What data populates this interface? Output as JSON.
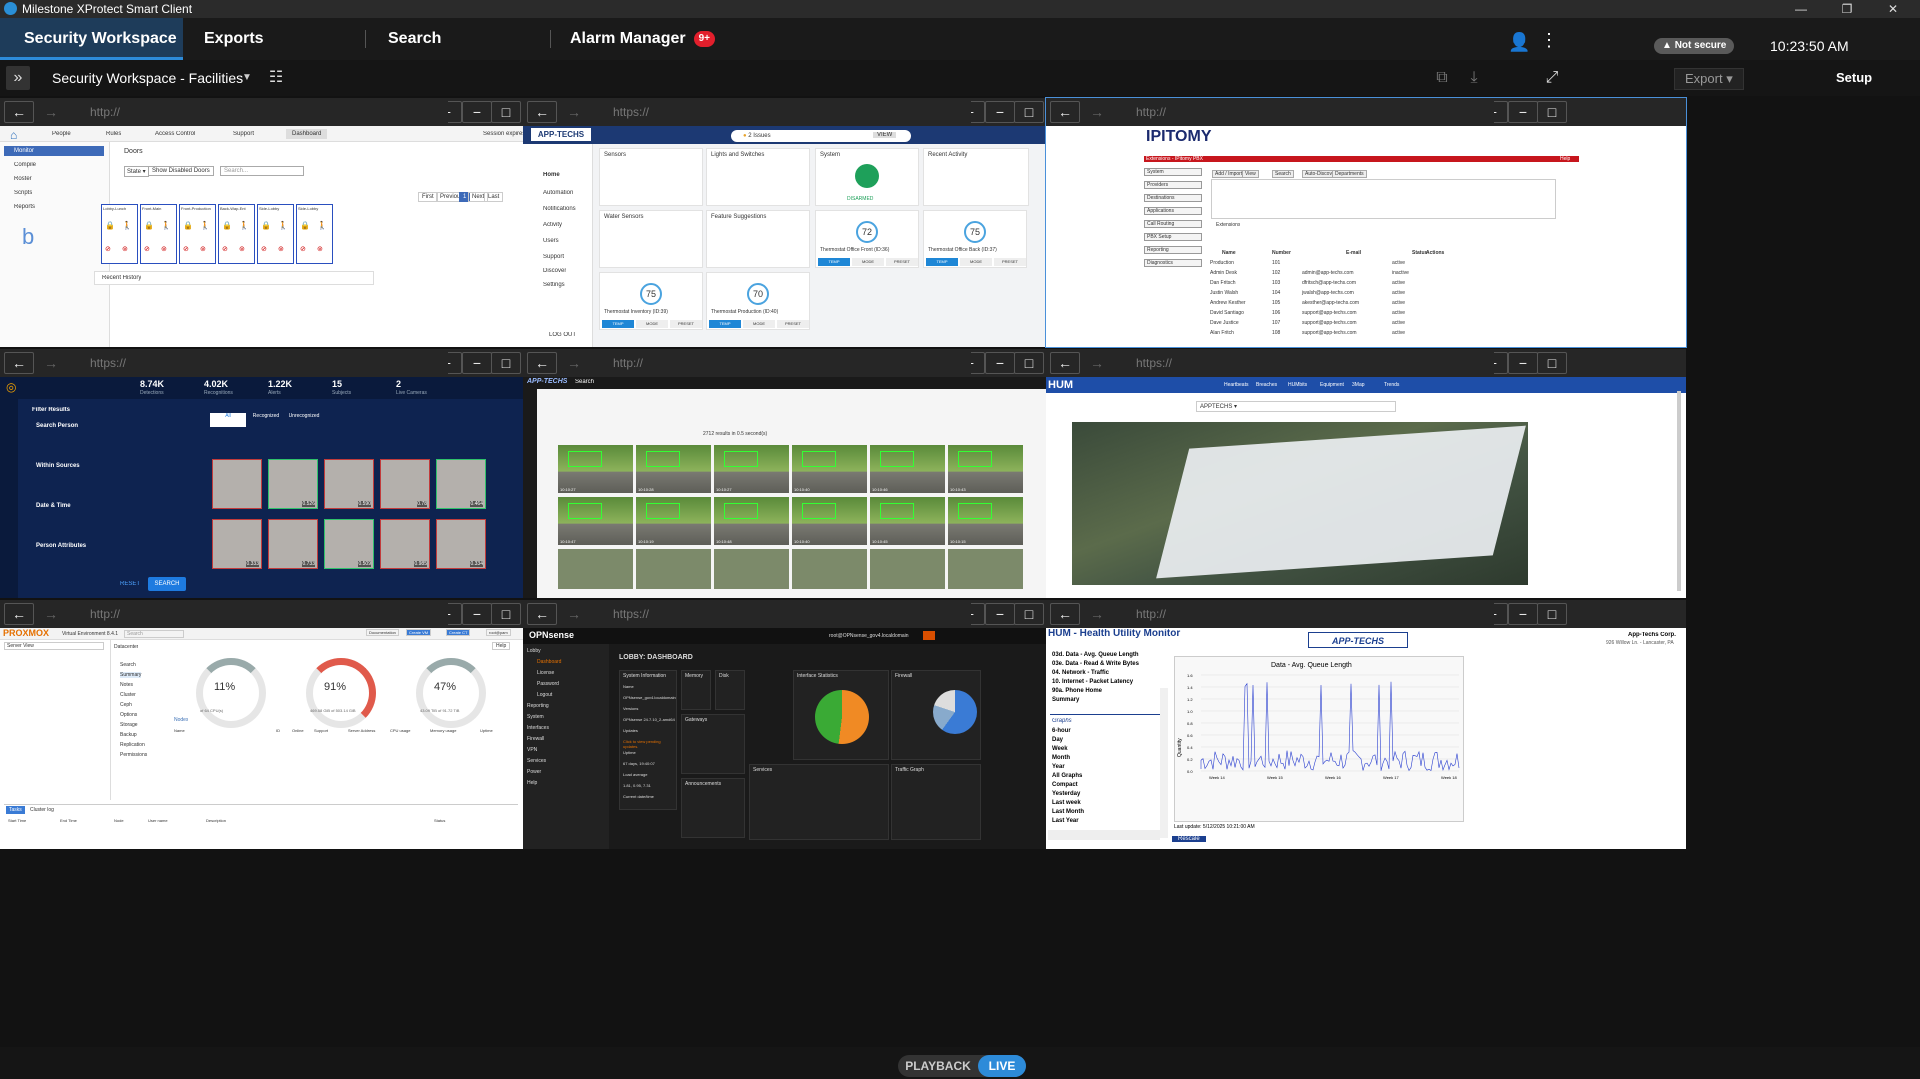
{
  "app": {
    "title": "Milestone XProtect Smart Client",
    "window_controls": [
      "—",
      "❐",
      "✕"
    ]
  },
  "tabs": [
    {
      "label": "Security Workspace -...",
      "active": true
    },
    {
      "label": "Exports",
      "active": false
    },
    {
      "label": "Search",
      "active": false
    },
    {
      "label": "Alarm Manager",
      "active": false,
      "badge": "9+"
    }
  ],
  "status": {
    "security": "Not secure",
    "time": "10:23:50 AM"
  },
  "workspace": {
    "name": "Security Workspace - Facilities",
    "export_label": "Export",
    "setup_label": "Setup"
  },
  "nav_icons": {
    "back": "←",
    "forward": "→",
    "home": "⌂",
    "reload": "⟳",
    "zoom_in": "+",
    "zoom_out": "−",
    "max": "□"
  },
  "panes": [
    {
      "url": "http://",
      "title": "Access control dashboard",
      "app": {
        "nav": [
          "People",
          "Rules",
          "Access Control",
          "Support",
          "Dashboard"
        ],
        "session": "Session expires in: 23h 58m 31s",
        "user": "admin",
        "side": [
          "Monitor",
          "Compile",
          "Roster",
          "Scripts",
          "Reports"
        ],
        "section": "Doors",
        "filters": [
          "Show Disabled Doors",
          "Search..."
        ],
        "pager": [
          "First",
          "Previous",
          "1",
          "Next",
          "Last"
        ],
        "doors": [
          "Lobby-Lunch",
          "Front-Main",
          "Front-Production",
          "Back-Wap-Ent",
          "Side-Lobby",
          "Side-Lobby"
        ],
        "history": "Recent History"
      }
    },
    {
      "url": "https://",
      "title": "Alarm.com home automation",
      "app": {
        "brand": "APP-TECHS",
        "alert": "2 Issues",
        "view": "VIEW",
        "side": [
          "Home",
          "Automation",
          "Notifications",
          "Activity",
          "Users",
          "Support",
          "Discover",
          "Settings"
        ],
        "logout": "LOG OUT",
        "cards": [
          "Sensors",
          "Lights and Switches",
          "System",
          "Recent Activity",
          "Water Sensors",
          "Feature Suggestions"
        ],
        "system_state": "DISARMED",
        "thermostats": [
          {
            "name": "Thermostat Office Front (ID:36)",
            "value": "72"
          },
          {
            "name": "Thermostat Office Back (ID:37)",
            "value": "75"
          },
          {
            "name": "Thermostat Inventory (ID:39)",
            "value": "75"
          },
          {
            "name": "Thermostat Production (ID:40)",
            "value": "70"
          }
        ],
        "modes": [
          "TEMP",
          "MODE",
          "PRESET"
        ]
      }
    },
    {
      "url": "http://",
      "title": "IPitomy PBX extensions",
      "app": {
        "brand": "IPITOMY",
        "topnav": [
          "Extensions",
          "Status",
          "Help"
        ],
        "title": "Extensions - IPitomy PBX",
        "side": [
          "System",
          "Providers",
          "Destinations",
          "Applications",
          "Call Routing",
          "PBX Setup",
          "Reporting",
          "Diagnostics"
        ],
        "tabs": [
          "Add / Import",
          "View",
          "Search",
          "Auto-Discovery",
          "Departments"
        ],
        "columns": [
          "Name",
          "Number",
          "E-mail",
          "Status",
          "Actions"
        ],
        "rows": [
          [
            "Production",
            "101",
            "",
            "active"
          ],
          [
            "Admin Desk",
            "102",
            "admin@app-techs.com",
            "inactive"
          ],
          [
            "Dan Fritsch",
            "103",
            "dfritsch@app-techs.com",
            "active"
          ],
          [
            "Justin Walsh",
            "104",
            "jwalsh@app-techs.com",
            "active"
          ],
          [
            "Andrew Kesther",
            "105",
            "akesther@app-techs.com",
            "active"
          ],
          [
            "David Santiago",
            "106",
            "support@app-techs.com",
            "active"
          ],
          [
            "Dave Justice",
            "107",
            "support@app-techs.com",
            "active"
          ],
          [
            "Alan Fritch",
            "108",
            "support@app-techs.com",
            "active"
          ]
        ]
      }
    },
    {
      "url": "https://",
      "title": "Face recognition analytics",
      "app": {
        "stats": [
          {
            "v": "8.74K",
            "l": "Detections"
          },
          {
            "v": "4.02K",
            "l": "Recognitions"
          },
          {
            "v": "1.22K",
            "l": "Alerts"
          },
          {
            "v": "15",
            "l": "Subjects"
          },
          {
            "v": "2",
            "l": "Live Cameras"
          }
        ],
        "filter_title": "Filter Results",
        "filters": [
          "Search Person",
          "Within Sources",
          "Date & Time",
          "Person Attributes"
        ],
        "tabs": [
          "All",
          "Recognized",
          "Unrecognized"
        ],
        "reset": "RESET",
        "search": "SEARCH",
        "scores": [
          "",
          "0.526",
          "0.590",
          "0.78",
          "0.464",
          "0.333",
          "0.733",
          "0.509",
          "0.985",
          "0.334"
        ]
      }
    },
    {
      "url": "http://",
      "title": "Video search",
      "app": {
        "brand": "APP-TECHS",
        "label": "Search",
        "summary": "2712 results in 0.5 second(s)",
        "times": [
          "10:10:27",
          "10:10:28",
          "10:10:27",
          "10:10:40",
          "10:10:46",
          "10:10:43",
          "10:10:47",
          "10:10:19",
          "10:10:48",
          "10:10:40",
          "10:10:45",
          "10:10:15"
        ]
      }
    },
    {
      "url": "https://",
      "title": "HUM dashboard",
      "app": {
        "brand": "HUM",
        "nav": [
          "Heartbeats",
          "Breaches",
          "HUMbits",
          "Equipment",
          "3Map",
          "Trends"
        ],
        "select": "APPTECHS"
      }
    },
    {
      "url": "http://",
      "title": "Proxmox VE",
      "app": {
        "brand": "PROXMOX",
        "sub": "Virtual Environment 8.4.1",
        "search": "Search",
        "buttons": [
          "Documentation",
          "Create VM",
          "Create CT",
          "root@pam"
        ],
        "view": "Server View",
        "crumb": "Datacenter",
        "menu": [
          "Search",
          "Summary",
          "Notes",
          "Cluster",
          "Ceph",
          "Options",
          "Storage",
          "Backup",
          "Replication",
          "Permissions"
        ],
        "gauges": [
          {
            "v": "11%",
            "l": "of 64 CPU(s)"
          },
          {
            "v": "91%",
            "l": "469.58 GiB of 503.14 GiB"
          },
          {
            "v": "47%",
            "l": "43.09 TiB of 91.72 TiB"
          }
        ],
        "nodes_title": "Nodes",
        "node_cols": [
          "Name",
          "ID",
          "Online",
          "Support",
          "Server Address",
          "CPU usage",
          "Memory usage",
          "Uptime"
        ],
        "tasks": [
          "Tasks",
          "Cluster log"
        ],
        "task_cols": [
          "Start Time",
          "End Time",
          "Node",
          "User name",
          "Description",
          "Status"
        ],
        "help": "Help"
      }
    },
    {
      "url": "https://",
      "title": "OPNsense dashboard",
      "app": {
        "brand": "OPNsense",
        "user": "root@OPNsense_gov4.localdomain",
        "title": "LOBBY: DASHBOARD",
        "menu": [
          "Lobby",
          "Dashboard",
          "License",
          "Password",
          "Logout",
          "Reporting",
          "System",
          "Interfaces",
          "Firewall",
          "VPN",
          "Services",
          "Power",
          "Help"
        ],
        "widgets": [
          "System Information",
          "Memory",
          "Disk",
          "Interface Statistics",
          "Firewall",
          "Gateways",
          "Services",
          "Traffic Graph",
          "Announcements"
        ],
        "info": [
          "Name",
          "OPNsense_gov4.localdomain",
          "Versions",
          "OPNsense 24.7.10_2-amd64",
          "Updates",
          "Click to view pending updates.",
          "Uptime",
          "67 days, 19:40:07",
          "Load average",
          "1.81, 0.95, 7.31",
          "Current date/time"
        ]
      }
    },
    {
      "url": "http://",
      "title": "HUM Health Utility Monitor",
      "app": {
        "title": "HUM - Health Utility Monitor",
        "brand": "APP-TECHS",
        "brand_sub": "Applying Technology Solutions",
        "company": "App-Techs Corp.",
        "address": "926 Willow Ln. - Lancaster, PA",
        "links": [
          "03d. Data - Avg. Queue Length",
          "03e. Data - Read & Write Bytes",
          "04. Network - Traffic",
          "10. Internet - Packet Latency",
          "90a. Phone Home",
          "Summary"
        ],
        "graphs_label": "Graphs",
        "periods": [
          "6-hour",
          "Day",
          "Week",
          "Month",
          "Year",
          "All Graphs",
          "Compact",
          "Yesterday",
          "Last week",
          "Last Month",
          "Last Year"
        ],
        "chart_title": "Data - Avg. Queue Length",
        "ylabel": "Quantity",
        "xticks": [
          "Week 14",
          "Week 15",
          "Week 16",
          "Week 17",
          "Week 18"
        ],
        "yticks": [
          "0.0",
          "0.2",
          "0.4",
          "0.6",
          "0.8",
          "1.0",
          "1.2",
          "1.4",
          "1.6"
        ],
        "last_update": "Last update: 5/12/2025 10:21:00 AM",
        "rescale": "Rescale"
      }
    }
  ],
  "bottom": {
    "playback": "PLAYBACK",
    "live": "LIVE"
  }
}
